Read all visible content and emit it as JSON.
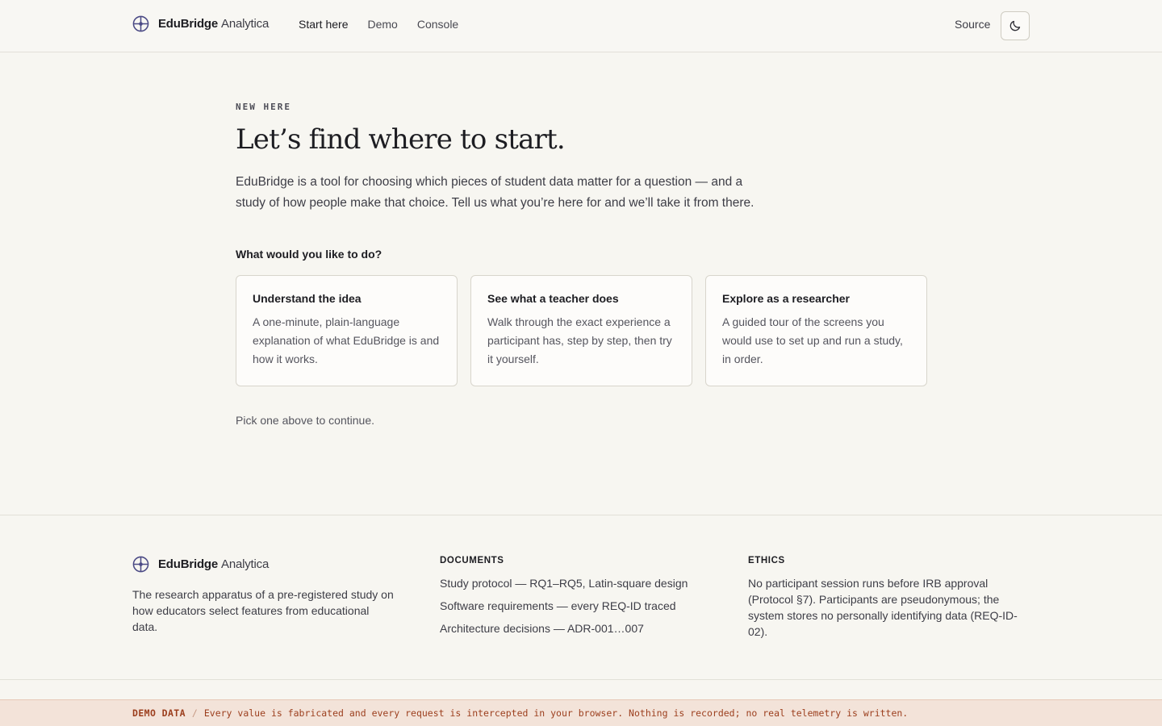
{
  "header": {
    "brand_strong": "EduBridge",
    "brand_light": "Analytica",
    "nav": [
      {
        "label": "Start here",
        "active": true
      },
      {
        "label": "Demo",
        "active": false
      },
      {
        "label": "Console",
        "active": false
      }
    ],
    "source_label": "Source",
    "theme_toggle_icon": "moon-icon"
  },
  "main": {
    "eyebrow": "NEW HERE",
    "headline": "Let’s find where to start.",
    "intro": "EduBridge is a tool for choosing which pieces of student data matter for a question — and a study of how people make that choice. Tell us what you’re here for and we’ll take it from there.",
    "question": "What would you like to do?",
    "cards": [
      {
        "title": "Understand the idea",
        "description": "A one-minute, plain-language explanation of what EduBridge is and how it works."
      },
      {
        "title": "See what a teacher does",
        "description": "Walk through the exact experience a participant has, step by step, then try it yourself."
      },
      {
        "title": "Explore as a researcher",
        "description": "A guided tour of the screens you would use to set up and run a study, in order."
      }
    ],
    "hint": "Pick one above to continue."
  },
  "footer": {
    "brand_strong": "EduBridge",
    "brand_light": "Analytica",
    "tagline": "The research apparatus of a pre-registered study on how educators select features from educational data.",
    "documents": {
      "heading": "DOCUMENTS",
      "links": [
        "Study protocol — RQ1–RQ5, Latin-square design",
        "Software requirements — every REQ-ID traced",
        "Architecture decisions — ADR-001…007"
      ]
    },
    "ethics": {
      "heading": "ETHICS",
      "text": "No participant session runs before IRB approval (Protocol §7). Participants are pseudonymous; the system stores no personally identifying data (REQ-ID-02)."
    }
  },
  "demo_banner": {
    "tag": "DEMO DATA",
    "separator": "/",
    "message": "Every value is fabricated and every request is intercepted in your browser. Nothing is recorded; no real telemetry is written."
  },
  "colors": {
    "background": "#f7f6f1",
    "brand_mark": "#4b4a85",
    "demo_banner_bg": "#f3e3d9",
    "demo_banner_text": "#9c3f1e"
  }
}
